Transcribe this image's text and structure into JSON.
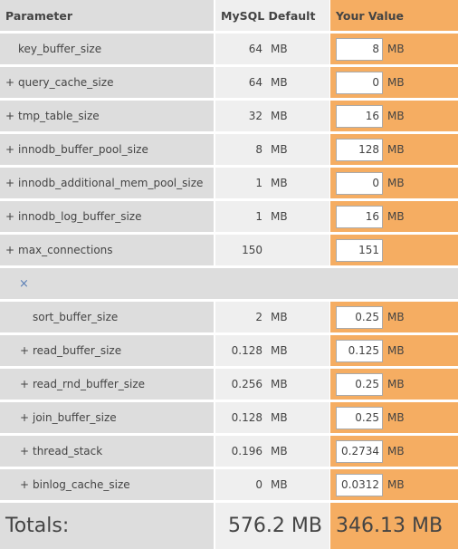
{
  "header": {
    "parameter": "Parameter",
    "default": "MySQL Default",
    "value": "Your Value"
  },
  "rows": [
    {
      "name": "key_buffer_size",
      "expandable": false,
      "nested": false,
      "default": "64",
      "default_unit": "MB",
      "value": "8",
      "unit": "MB"
    },
    {
      "name": "query_cache_size",
      "expandable": true,
      "nested": false,
      "default": "64",
      "default_unit": "MB",
      "value": "0",
      "unit": "MB"
    },
    {
      "name": "tmp_table_size",
      "expandable": true,
      "nested": false,
      "default": "32",
      "default_unit": "MB",
      "value": "16",
      "unit": "MB"
    },
    {
      "name": "innodb_buffer_pool_size",
      "expandable": true,
      "nested": false,
      "default": "8",
      "default_unit": "MB",
      "value": "128",
      "unit": "MB"
    },
    {
      "name": "innodb_additional_mem_pool_size",
      "expandable": true,
      "nested": false,
      "default": "1",
      "default_unit": "MB",
      "value": "0",
      "unit": "MB"
    },
    {
      "name": "innodb_log_buffer_size",
      "expandable": true,
      "nested": false,
      "default": "1",
      "default_unit": "MB",
      "value": "16",
      "unit": "MB"
    },
    {
      "name": "max_connections",
      "expandable": true,
      "nested": false,
      "default": "150",
      "default_unit": "",
      "value": "151",
      "unit": ""
    },
    {
      "separator": "×"
    },
    {
      "name": "sort_buffer_size",
      "expandable": false,
      "nested": true,
      "default": "2",
      "default_unit": "MB",
      "value": "0.25",
      "unit": "MB"
    },
    {
      "name": "read_buffer_size",
      "expandable": true,
      "nested": true,
      "default": "0.128",
      "default_unit": "MB",
      "value": "0.125",
      "unit": "MB"
    },
    {
      "name": "read_rnd_buffer_size",
      "expandable": true,
      "nested": true,
      "default": "0.256",
      "default_unit": "MB",
      "value": "0.25",
      "unit": "MB"
    },
    {
      "name": "join_buffer_size",
      "expandable": true,
      "nested": true,
      "default": "0.128",
      "default_unit": "MB",
      "value": "0.25",
      "unit": "MB"
    },
    {
      "name": "thread_stack",
      "expandable": true,
      "nested": true,
      "default": "0.196",
      "default_unit": "MB",
      "value": "0.2734",
      "unit": "MB"
    },
    {
      "name": "binlog_cache_size",
      "expandable": true,
      "nested": true,
      "default": "0",
      "default_unit": "MB",
      "value": "0.0312",
      "unit": "MB"
    }
  ],
  "totals": {
    "label": "Totals:",
    "default": "576.2 MB",
    "value": "346.13 MB"
  },
  "plus_symbol": "+"
}
